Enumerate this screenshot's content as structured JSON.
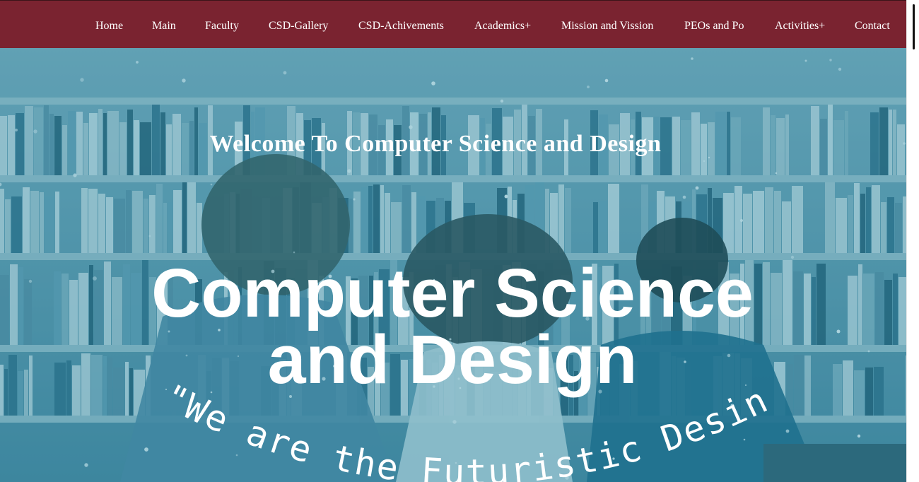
{
  "nav": {
    "items": [
      {
        "label": "Home"
      },
      {
        "label": "Main"
      },
      {
        "label": "Faculty"
      },
      {
        "label": "CSD-Gallery"
      },
      {
        "label": "CSD-Achivements"
      },
      {
        "label": "Academics+"
      },
      {
        "label": "Mission and Vission"
      },
      {
        "label": "PEOs and Po"
      },
      {
        "label": "Activities+"
      },
      {
        "label": "Contact"
      }
    ],
    "bg_color": "#7a2330"
  },
  "hero": {
    "welcome": "Welcome To Computer Science and Design",
    "title_line1": "Computer Science",
    "title_line2": "and Design",
    "tagline": "\"We are the Futuristic Desingers\"",
    "tint_color": "#2a8aa6"
  }
}
